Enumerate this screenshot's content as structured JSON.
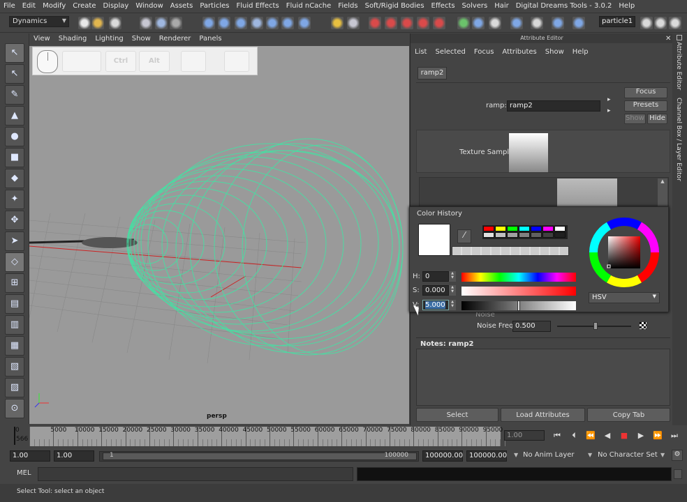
{
  "menubar": [
    "File",
    "Edit",
    "Modify",
    "Create",
    "Display",
    "Window",
    "Assets",
    "Particles",
    "Fluid Effects",
    "Fluid nCache",
    "Fields",
    "Soft/Rigid Bodies",
    "Effects",
    "Solvers",
    "Hair",
    "Digital Dreams Tools - 3.0.2",
    "Help"
  ],
  "shelf": {
    "mode": "Dynamics",
    "object_field": "particle1"
  },
  "viewport": {
    "menu": [
      "View",
      "Shading",
      "Lighting",
      "Show",
      "Renderer",
      "Panels"
    ],
    "camera_label": "persp",
    "hud_keys": [
      "Ctrl",
      "Alt"
    ]
  },
  "attribute_editor": {
    "title": "Attribute Editor",
    "menu": [
      "List",
      "Selected",
      "Focus",
      "Attributes",
      "Show",
      "Help"
    ],
    "node_tab": "ramp2",
    "node_label": "ramp:",
    "node_value": "ramp2",
    "focus_btn": "Focus",
    "presets_btn": "Presets",
    "show_btn": "Show",
    "hide_btn": "Hide",
    "texture_sample_label": "Texture Sample",
    "noise_label": "Noise",
    "noise_freq_label": "Noise Freq",
    "noise_freq_value": "0.500",
    "notes_label": "Notes:  ramp2",
    "select_btn": "Select",
    "load_btn": "Load Attributes",
    "copy_btn": "Copy Tab"
  },
  "side_tabs": {
    "tab1": "Attribute Editor",
    "tab2": "Channel Box / Layer Editor"
  },
  "color_picker": {
    "history_label": "Color History",
    "h_label": "H:",
    "h_value": "0",
    "s_label": "S:",
    "s_value": "0.000",
    "v_label": "V:",
    "v_value": "5.000",
    "mode": "HSV",
    "history_colors": [
      "#ff0000",
      "#ffff00",
      "#00ff00",
      "#00ffff",
      "#0000ff",
      "#ff00ff",
      "#ffffff",
      "#e0e0e0",
      "#c0c0c0",
      "#a0a0a0",
      "#808080",
      "#606060",
      "#404040",
      "#202020"
    ]
  },
  "timeline": {
    "ticks": [
      "0",
      "5000",
      "10000",
      "15000",
      "20000",
      "25000",
      "30000",
      "35000",
      "40000",
      "45000",
      "50000",
      "55000",
      "60000",
      "65000",
      "70000",
      "75000",
      "80000",
      "85000",
      "90000",
      "95000"
    ],
    "current_frame": "566",
    "current_time_field": "1.00"
  },
  "range": {
    "start": "1.00",
    "playback_start": "1.00",
    "slider_start": "1",
    "slider_end": "100000",
    "playback_end": "100000.00",
    "end": "100000.00",
    "anim_layer": "No Anim Layer",
    "char_set": "No Character Set"
  },
  "command_line": {
    "label": "MEL"
  },
  "help_line": {
    "text": "Select Tool: select an object"
  }
}
